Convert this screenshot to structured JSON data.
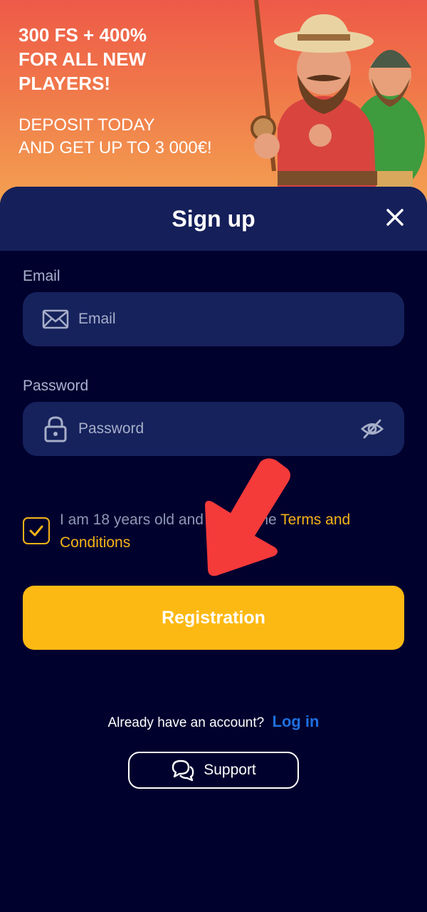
{
  "promo": {
    "title": "300 FS + 400%\nFOR ALL NEW\nPLAYERS!",
    "subtitle": "DEPOSIT TODAY\nAND GET UP TO 3 000€!"
  },
  "signup": {
    "title": "Sign up",
    "email": {
      "label": "Email",
      "placeholder": "Email",
      "value": ""
    },
    "password": {
      "label": "Password",
      "placeholder": "Password",
      "value": ""
    },
    "consent": {
      "text": "I am 18 years old and accept the ",
      "link": "Terms and Conditions",
      "checked": true
    },
    "register_label": "Registration",
    "login_prompt": "Already have an account?",
    "login_link": "Log in",
    "support_label": "Support"
  },
  "colors": {
    "accent": "#fdb913",
    "sheet_background": "#01012e",
    "header_background": "#15205a",
    "link": "#1f6fe0",
    "annotation_arrow": "#f53a3a"
  },
  "icons": [
    "close-icon",
    "mail-icon",
    "lock-icon",
    "eye-off-icon",
    "check-icon",
    "chat-bubbles-icon",
    "red-arrow-annotation"
  ]
}
